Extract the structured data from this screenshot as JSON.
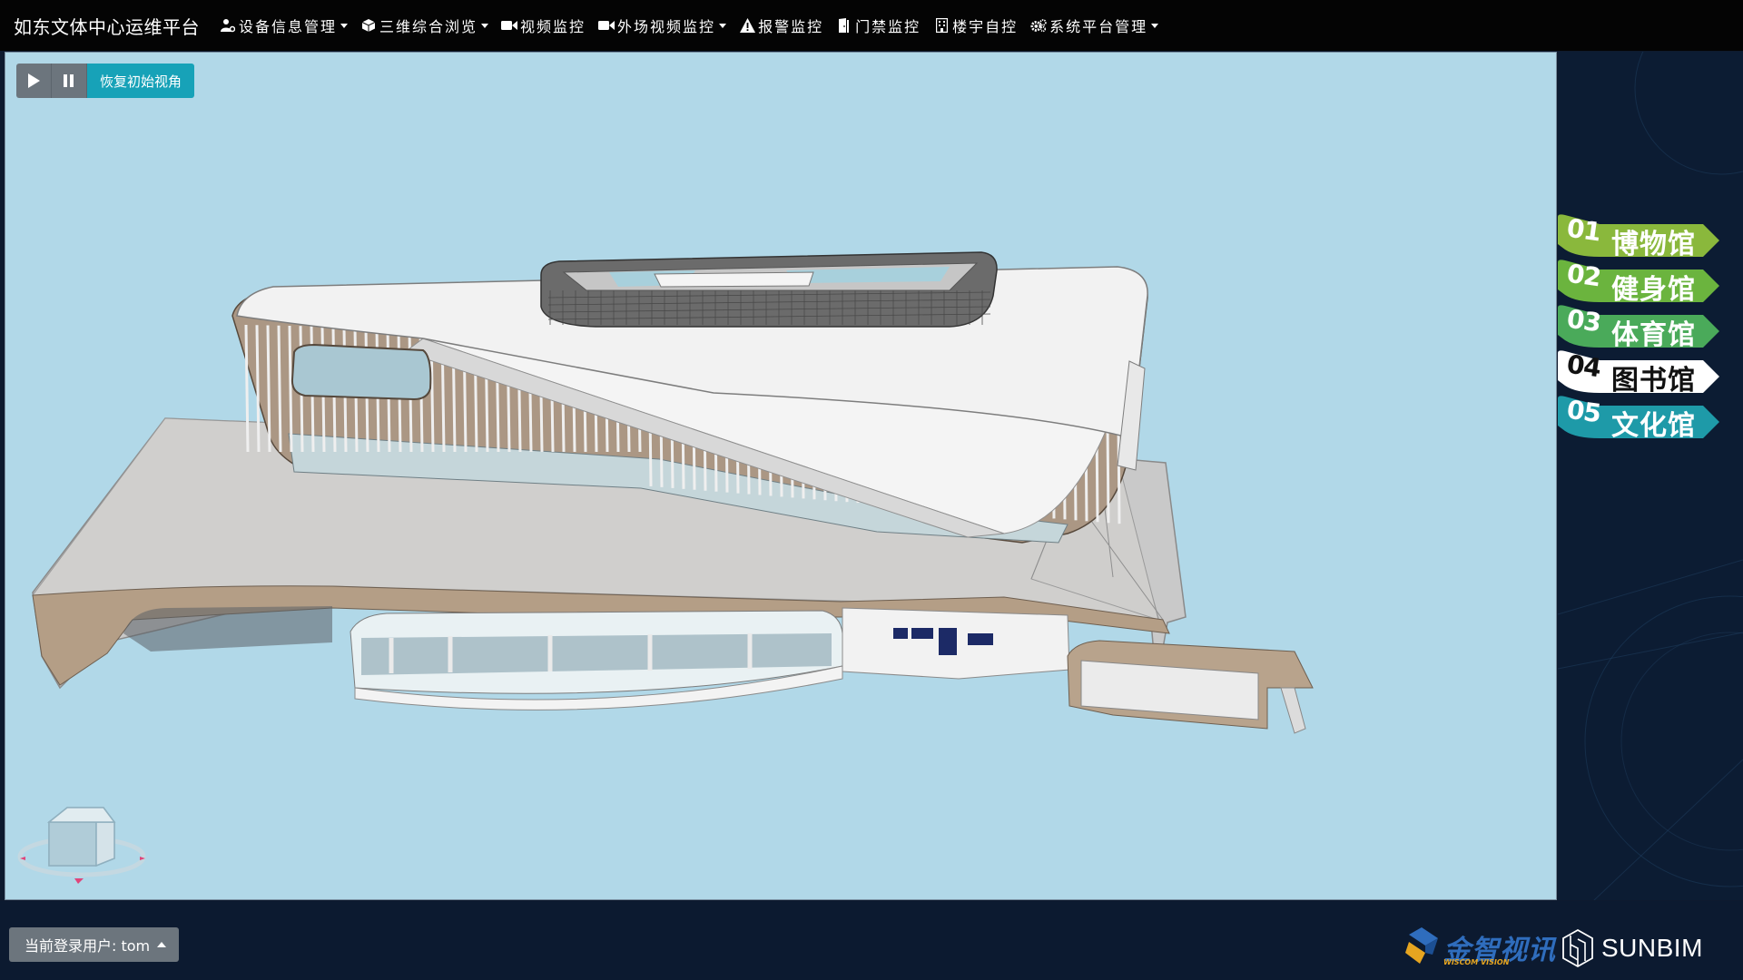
{
  "app": {
    "title": "如东文体中心运维平台"
  },
  "nav": [
    {
      "label": "设备信息管理",
      "icon": "users-cog-icon",
      "dropdown": true
    },
    {
      "label": "三维综合浏览",
      "icon": "cube-icon",
      "dropdown": true
    },
    {
      "label": "视频监控",
      "icon": "video-camera-icon",
      "dropdown": false
    },
    {
      "label": "外场视频监控",
      "icon": "video-camera-icon",
      "dropdown": true
    },
    {
      "label": "报警监控",
      "icon": "warning-icon",
      "dropdown": false
    },
    {
      "label": "门禁监控",
      "icon": "door-icon",
      "dropdown": false
    },
    {
      "label": "楼宇自控",
      "icon": "building-icon",
      "dropdown": false
    },
    {
      "label": "系统平台管理",
      "icon": "gears-icon",
      "dropdown": true
    }
  ],
  "viewer": {
    "play_icon": "play-icon",
    "pause_icon": "pause-icon",
    "reset_label": "恢复初始视角"
  },
  "venues": [
    {
      "num": "01",
      "label": "博物馆",
      "color": "#8ab83c",
      "text_color": "#ffffff",
      "num_color": "#ffffff"
    },
    {
      "num": "02",
      "label": "健身馆",
      "color": "#6bb43e",
      "text_color": "#ffffff",
      "num_color": "#ffffff"
    },
    {
      "num": "03",
      "label": "体育馆",
      "color": "#4aaa5a",
      "text_color": "#ffffff",
      "num_color": "#ffffff"
    },
    {
      "num": "04",
      "label": "图书馆",
      "color": "#ffffff",
      "text_color": "#111111",
      "num_color": "#111111"
    },
    {
      "num": "05",
      "label": "文化馆",
      "color": "#1e9aa8",
      "text_color": "#ffffff",
      "num_color": "#ffffff"
    }
  ],
  "footer": {
    "user_label": "当前登录用户: tom",
    "logo_cn": "金智视讯",
    "logo_en": "WISCOM VISION",
    "logo_sunbim": "SUNBIM"
  }
}
